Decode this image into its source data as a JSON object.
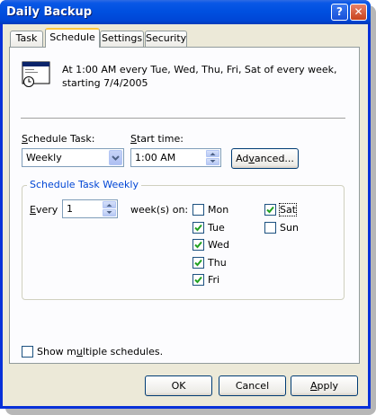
{
  "window": {
    "title": "Daily Backup",
    "help_glyph": "?",
    "close_glyph": "✕"
  },
  "tabs": [
    {
      "label": "Task"
    },
    {
      "label": "Schedule"
    },
    {
      "label": "Settings"
    },
    {
      "label": "Security"
    }
  ],
  "schedule": {
    "summary": "At 1:00 AM every Tue, Wed, Thu, Fri, Sat of every week, starting 7/4/2005",
    "task_label_pre": "",
    "task_label_u": "S",
    "task_label_post": "chedule Task:",
    "task_value": "Weekly",
    "start_label_pre": "",
    "start_label_u": "S",
    "start_label_post": "tart time:",
    "start_value": "1:00 AM",
    "advanced_pre": "Ad",
    "advanced_u": "v",
    "advanced_post": "anced..."
  },
  "weekly_group": {
    "title": "Schedule Task Weekly",
    "every_pre": "",
    "every_u": "E",
    "every_post": "very",
    "every_value": "1",
    "weeks_on": "week(s) on:",
    "days": [
      {
        "label": "Mon",
        "checked": false
      },
      {
        "label": "Tue",
        "checked": true
      },
      {
        "label": "Wed",
        "checked": true
      },
      {
        "label": "Thu",
        "checked": true
      },
      {
        "label": "Fri",
        "checked": true
      },
      {
        "label": "Sat",
        "checked": true
      },
      {
        "label": "Sun",
        "checked": false
      }
    ]
  },
  "multiple": {
    "label_pre": "Show m",
    "label_u": "u",
    "label_post": "ltiple schedules.",
    "checked": false
  },
  "buttons": {
    "ok": "OK",
    "cancel": "Cancel",
    "apply_u": "A",
    "apply_post": "pply"
  },
  "colors": {
    "titlebar": "#0054e3",
    "face": "#ece9d8",
    "group_title": "#0046d5",
    "tab_highlight": "#ffc83c"
  }
}
